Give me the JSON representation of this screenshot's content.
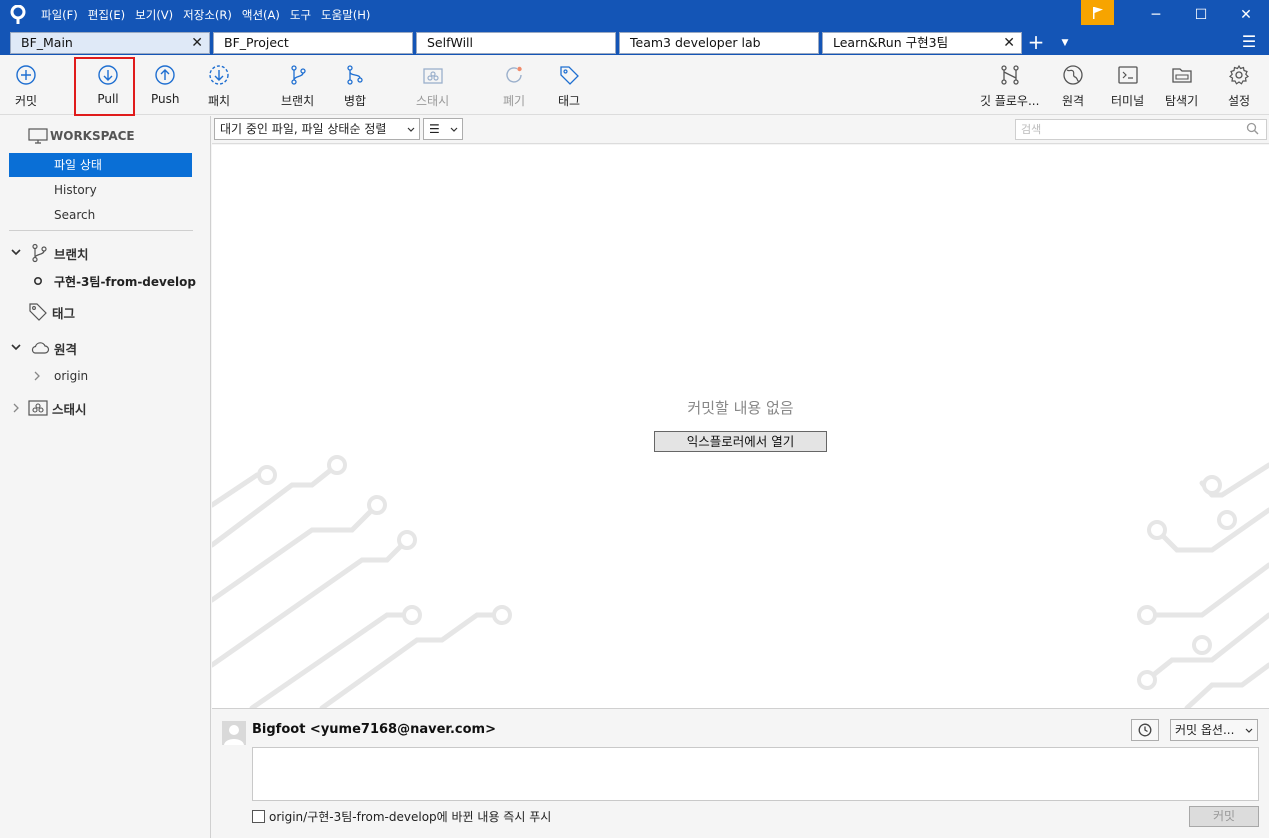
{
  "menu": [
    "파일(F)",
    "편집(E)",
    "보기(V)",
    "저장소(R)",
    "액션(A)",
    "도구",
    "도움말(H)"
  ],
  "window": {
    "minimize": "─",
    "maximize": "☐",
    "close": "✕"
  },
  "tabs": [
    {
      "label": "BF_Main",
      "closable": true
    },
    {
      "label": "BF_Project"
    },
    {
      "label": "SelfWill"
    },
    {
      "label": "Team3 developer lab"
    },
    {
      "label": "Learn&Run 구현3팀",
      "closable": true,
      "active": true
    }
  ],
  "tab_close": "✕",
  "tab_add": "+",
  "tab_more": "▼",
  "tab_menu": "☰",
  "toolbar": {
    "commit": "커밋",
    "pull": "Pull",
    "push": "Push",
    "fetch": "패치",
    "branch": "브랜치",
    "merge": "병합",
    "stash": "스태시",
    "discard": "폐기",
    "tag": "태그",
    "gitflow": "깃 플로우...",
    "remote": "원격",
    "terminal": "터미널",
    "explorer": "탐색기",
    "settings": "설정"
  },
  "sidebar": {
    "workspace": "WORKSPACE",
    "workspace_items": [
      "파일 상태",
      "History",
      "Search"
    ],
    "branches": "브랜치",
    "current_branch": "구현-3팀-from-develop",
    "tags": "태그",
    "remotes": "원격",
    "remote_items": [
      "origin"
    ],
    "stashes": "스태시"
  },
  "filter": {
    "sort_label": "대기 중인 파일, 파일 상태순 정렬",
    "view_label": "☰",
    "search_placeholder": "검색"
  },
  "main": {
    "empty_text": "커밋할 내용 없음",
    "open_explorer": "익스플로러에서 열기"
  },
  "commit": {
    "author": "Bigfoot <yume7168@naver.com>",
    "options": "커밋 옵션...",
    "push_label": "origin/구현-3팀-from-develop에 바뀐 내용 즉시 푸시",
    "button": "커밋"
  },
  "colors": {
    "titlebar": "#1455b6",
    "selection": "#0a6fd6",
    "highlight": "#e01b1b",
    "flag": "#f7a400"
  }
}
